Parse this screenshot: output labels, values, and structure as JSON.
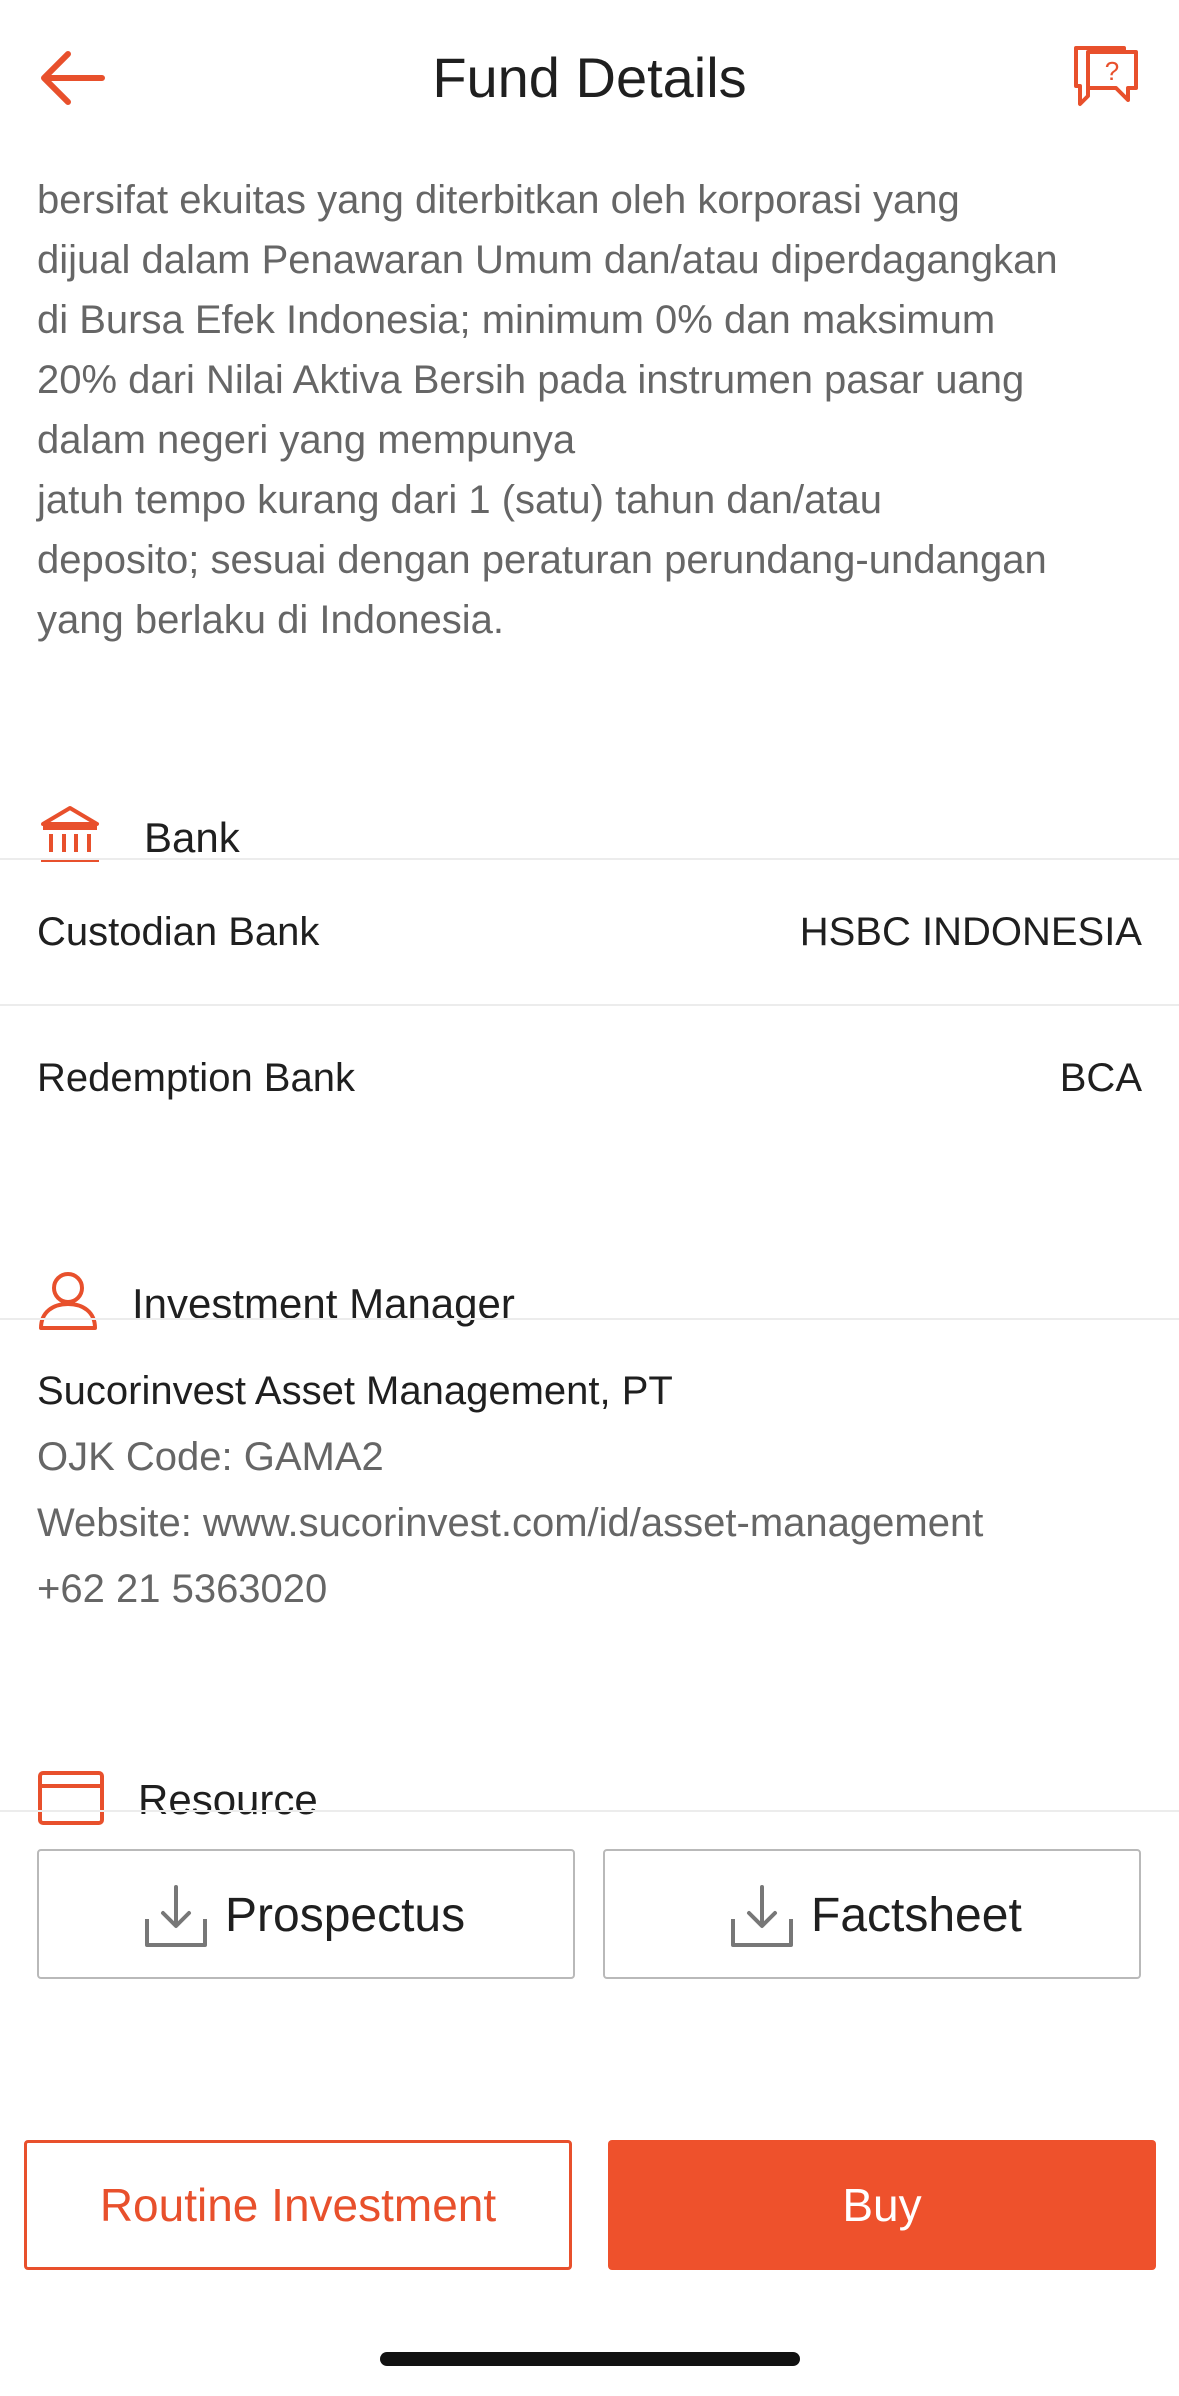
{
  "header": {
    "title": "Fund Details",
    "back_icon": "arrow-left-icon",
    "chat_icon": "help-chat-icon"
  },
  "description": {
    "truncated_line": ".",
    "lines": [
      "bersifat ekuitas yang diterbitkan oleh korporasi yang",
      "dijual dalam Penawaran Umum dan/atau diperdagangkan",
      "di Bursa Efek Indonesia; minimum 0% dan maksimum",
      "20% dari Nilai Aktiva Bersih pada instrumen pasar uang",
      "dalam negeri yang mempunya",
      "jatuh tempo kurang dari 1 (satu) tahun dan/atau",
      "deposito; sesuai dengan peraturan perundang-undangan",
      "yang berlaku di Indonesia."
    ]
  },
  "bank": {
    "heading": "Bank",
    "icon": "bank-icon",
    "custodian_label": "Custodian Bank",
    "custodian_value": "HSBC INDONESIA",
    "redemption_label": "Redemption Bank",
    "redemption_value": "BCA"
  },
  "investment_manager": {
    "heading": "Investment Manager",
    "icon": "user-icon",
    "name": "Sucorinvest Asset Management, PT",
    "ojk_code": "OJK Code: GAMA2",
    "website": "Website: www.sucorinvest.com/id/asset-management",
    "phone": "+62 21 5363020"
  },
  "resource": {
    "heading": "Resource",
    "icon": "card-icon",
    "prospectus_label": "Prospectus",
    "factsheet_label": "Factsheet"
  },
  "footer": {
    "routine_label": "Routine Investment",
    "buy_label": "Buy"
  },
  "colors": {
    "accent": "#ee512c",
    "text_primary": "#1f1f1f",
    "text_secondary": "#666666",
    "divider": "#ececec"
  }
}
